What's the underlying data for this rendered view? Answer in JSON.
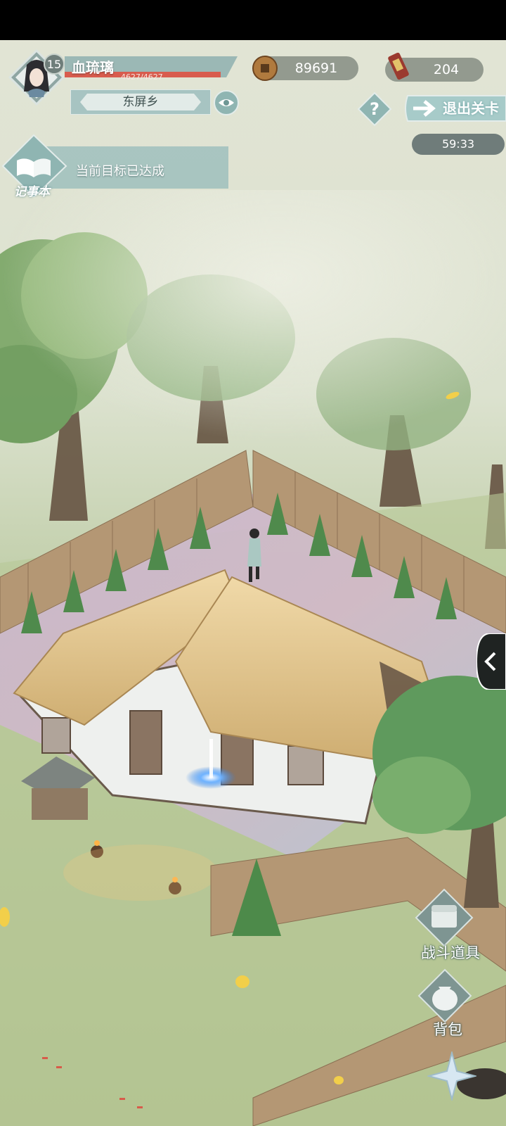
{
  "player": {
    "level": "15",
    "name": "血琉璃",
    "hp_text": "4627/4627"
  },
  "location": {
    "name": "东屏乡"
  },
  "currency": {
    "coins": "89691",
    "tokens": "204"
  },
  "top_right": {
    "exit_label": "退出关卡",
    "timer": "59:33"
  },
  "quest": {
    "status_text": "当前目标已达成",
    "notebook_label": "记事本"
  },
  "actions": {
    "battle_items_label": "战斗道具",
    "backpack_label": "背包"
  },
  "colors": {
    "hud_teal": "#a7c7c4",
    "hp_red": "#d85c4e",
    "grass": "#b9c99a",
    "thatch": "#e6c98f"
  }
}
